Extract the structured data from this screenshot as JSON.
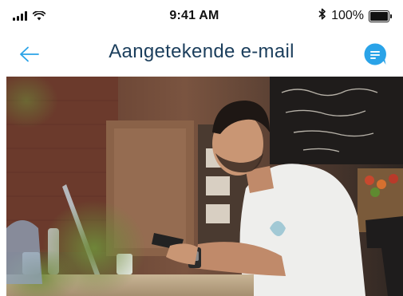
{
  "status_bar": {
    "time": "9:41 AM",
    "battery_text": "100%",
    "icons": [
      "signal-icon",
      "wifi-icon",
      "bluetooth-icon",
      "battery-icon"
    ]
  },
  "nav": {
    "title": "Aangetekende e-mail",
    "back_icon": "arrow-left-icon",
    "chat_icon": "chat-bubble-icon"
  },
  "colors": {
    "accent": "#2aa3e8",
    "title": "#1b3e5c",
    "status_text": "#111111"
  }
}
